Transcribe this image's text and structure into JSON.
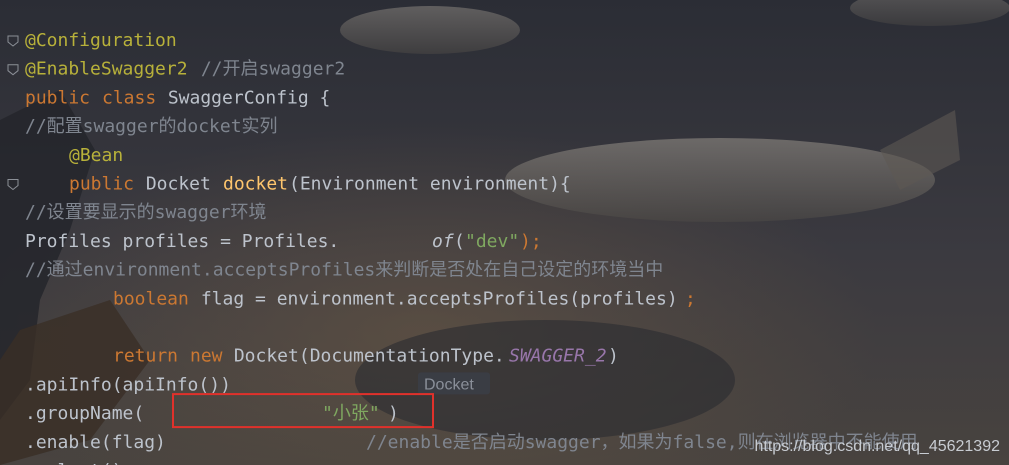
{
  "theme": {
    "annotation": "#b8b13a",
    "keyword": "#cc7832",
    "plain": "#bdc3cc",
    "comment": "#7f858f",
    "string": "#7fa860",
    "static_field": "#9876aa",
    "method": "#ffc66d",
    "param_hint_text": "#8a8f99",
    "highlight_box": "#e0312b",
    "watermark_text": "#c8ccd2"
  },
  "code_lines": [
    {
      "tokens": [
        {
          "t": "@Configuration",
          "k": "annotation"
        }
      ],
      "fold": true
    },
    {
      "tokens": [
        {
          "t": "@EnableSwagger2",
          "k": "annotation"
        },
        {
          "t": "  //开启swagger2",
          "k": "comment"
        }
      ],
      "fold": true
    },
    {
      "tokens": [
        {
          "t": "public",
          "k": "keyword"
        },
        {
          "t": " ",
          "k": "plain"
        },
        {
          "t": "class",
          "k": "keyword"
        },
        {
          "t": " SwaggerConfig {",
          "k": "plain"
        }
      ]
    },
    {
      "tokens": [
        {
          "t": "    //配置swagger的docket实列",
          "k": "comment"
        }
      ]
    },
    {
      "tokens": [
        {
          "t": "    ",
          "k": "plain"
        },
        {
          "t": "@Bean",
          "k": "annotation"
        }
      ]
    },
    {
      "tokens": [
        {
          "t": "    ",
          "k": "plain"
        },
        {
          "t": "public",
          "k": "keyword"
        },
        {
          "t": " Docket ",
          "k": "plain"
        },
        {
          "t": "docket",
          "k": "method"
        },
        {
          "t": "(Environment environment){",
          "k": "plain"
        }
      ],
      "fold": true
    },
    {
      "tokens": [
        {
          "t": "        //设置要显示的swagger环境",
          "k": "comment"
        }
      ]
    },
    {
      "tokens": [
        {
          "t": "        Profiles profiles = Profiles.",
          "k": "plain"
        },
        {
          "t": "of",
          "k": "italic"
        },
        {
          "t": "(",
          "k": "plain"
        },
        {
          "t": "\"dev\"",
          "k": "string"
        },
        {
          "t": ");",
          "k": "keyword"
        }
      ]
    },
    {
      "tokens": [
        {
          "t": "        //通过environment.acceptsProfiles来判断是否处在自己设定的环境当中",
          "k": "comment"
        }
      ]
    },
    {
      "tokens": [
        {
          "t": "        ",
          "k": "plain"
        },
        {
          "t": "boolean",
          "k": "keyword"
        },
        {
          "t": " flag = environment.acceptsProfiles(profiles)",
          "k": "plain"
        },
        {
          "t": ";",
          "k": "keyword"
        }
      ]
    },
    {
      "tokens": []
    },
    {
      "tokens": [
        {
          "t": "        ",
          "k": "plain"
        },
        {
          "t": "return",
          "k": "keyword"
        },
        {
          "t": " ",
          "k": "plain"
        },
        {
          "t": "new",
          "k": "keyword"
        },
        {
          "t": " Docket(DocumentationType.",
          "k": "plain"
        },
        {
          "t": "SWAGGER_2",
          "k": "static_field"
        },
        {
          "t": ")",
          "k": "plain"
        }
      ]
    },
    {
      "tokens": [
        {
          "t": "                .apiInfo(apiInfo())",
          "k": "plain"
        }
      ],
      "hint": "Docket"
    },
    {
      "tokens": [
        {
          "t": "                .groupName(",
          "k": "plain"
        },
        {
          "t": "\"小张\"",
          "k": "string"
        },
        {
          "t": ")",
          "k": "plain"
        }
      ],
      "highlight": true
    },
    {
      "tokens": [
        {
          "t": "                .enable(flag)  ",
          "k": "plain"
        },
        {
          "t": "//enable是否启动swagger，如果为false,则在浏览器中不能使用",
          "k": "comment"
        }
      ]
    },
    {
      "tokens": [
        {
          "t": "                .select()",
          "k": "plain"
        }
      ]
    }
  ],
  "watermark": "https://blog.csdn.net/qq_45621392"
}
